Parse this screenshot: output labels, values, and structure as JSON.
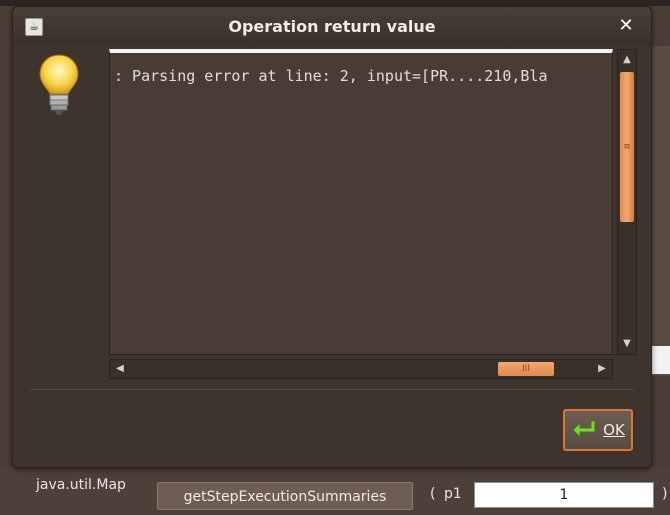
{
  "dialog": {
    "title": "Operation return value",
    "close_glyph": "✕",
    "window_icon": "java-window-icon",
    "info_icon": "lightbulb-icon",
    "return_text": ": Parsing error at line: 2, input=[PR....210,Bla",
    "ok_label": "OK",
    "ok_icon": "enter-arrow-icon"
  },
  "background_form": {
    "return_type": "java.util.Map",
    "operation_name": "getStepExecutionSummaries",
    "paren_open": "(",
    "param_name": "p1",
    "param_value": "1",
    "paren_close": ")"
  },
  "colors": {
    "accent": "#e08a4f",
    "dialog_bg": "#3e332d",
    "text": "#e4ddd6"
  }
}
